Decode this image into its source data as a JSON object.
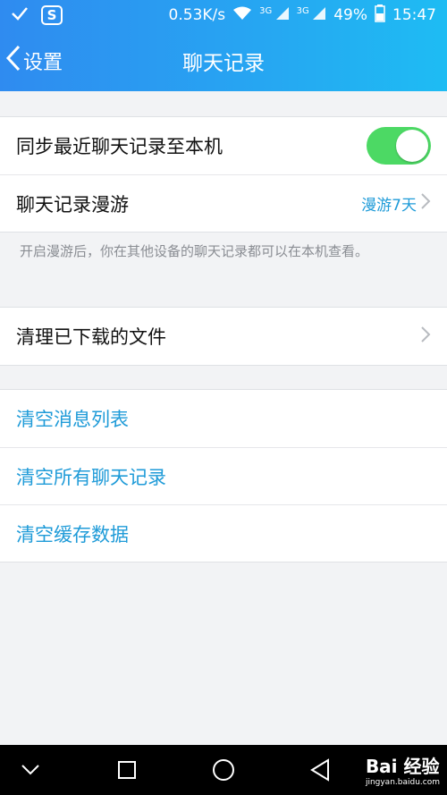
{
  "status_bar": {
    "speed": "0.53K/s",
    "network_1": "3G",
    "network_2": "3G",
    "battery": "49%",
    "time": "15:47",
    "app_badge": "S"
  },
  "nav": {
    "back_label": "设置",
    "title": "聊天记录"
  },
  "sync_section": {
    "sync_label": "同步最近聊天记录至本机",
    "sync_enabled": true,
    "roam_label": "聊天记录漫游",
    "roam_value": "漫游7天",
    "hint": "开启漫游后，你在其他设备的聊天记录都可以在本机查看。"
  },
  "files_section": {
    "clear_downloads_label": "清理已下载的文件"
  },
  "clear_section": {
    "clear_messages_label": "清空消息列表",
    "clear_chats_label": "清空所有聊天记录",
    "clear_cache_label": "清空缓存数据"
  },
  "watermark": {
    "brand": "Bai 经验",
    "site": "jingyan.baidu.com"
  },
  "colors": {
    "accent": "#1f9bd8",
    "toggle_on": "#4cd964",
    "header": "#26a7f2"
  }
}
